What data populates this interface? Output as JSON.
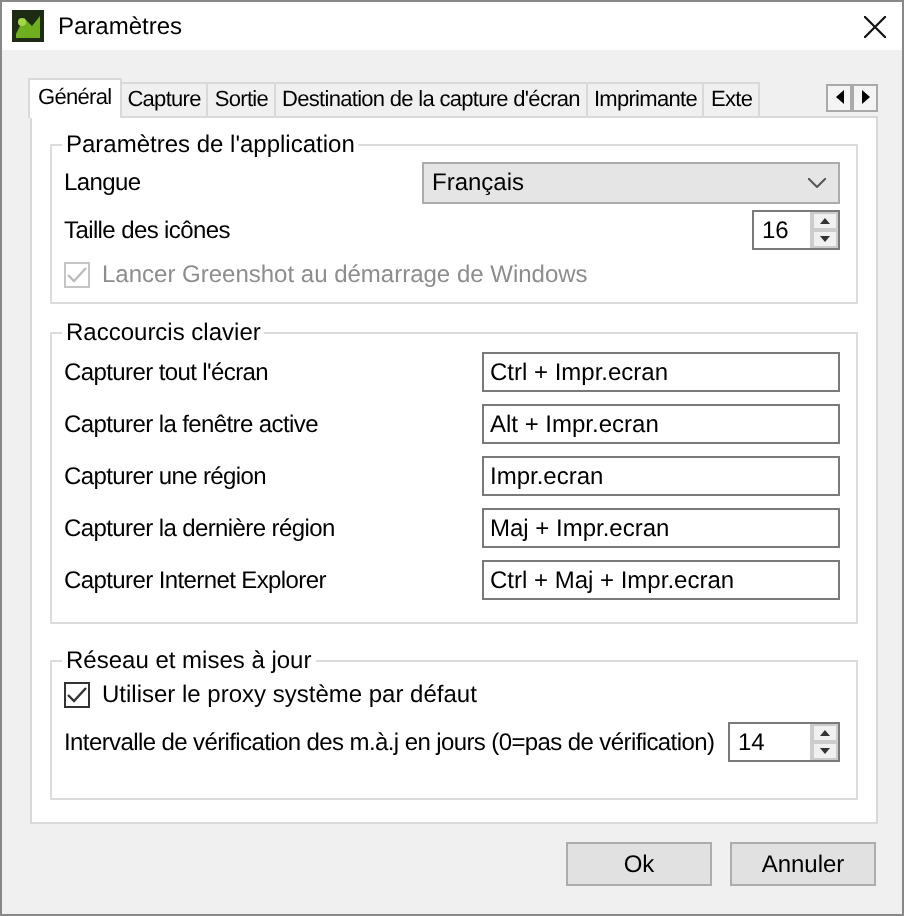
{
  "window": {
    "title": "Paramètres"
  },
  "tabs": [
    {
      "label": "Général",
      "selected": true
    },
    {
      "label": "Capture",
      "selected": false
    },
    {
      "label": "Sortie",
      "selected": false
    },
    {
      "label": "Destination de la capture d'écran",
      "selected": false
    },
    {
      "label": "Imprimante",
      "selected": false
    },
    {
      "label": "Exte",
      "selected": false
    }
  ],
  "application": {
    "legend": "Paramètres de l'application",
    "language": {
      "label": "Langue",
      "value": "Français"
    },
    "icon_size": {
      "label": "Taille des icônes",
      "value": "16"
    },
    "autostart": {
      "label": "Lancer Greenshot au démarrage de Windows",
      "checked": true,
      "disabled": true
    }
  },
  "hotkeys": {
    "legend": "Raccourcis clavier",
    "rows": [
      {
        "label": "Capturer tout l'écran",
        "value": "Ctrl + Impr.ecran"
      },
      {
        "label": "Capturer la fenêtre active",
        "value": "Alt + Impr.ecran"
      },
      {
        "label": "Capturer une région",
        "value": "Impr.ecran"
      },
      {
        "label": "Capturer la dernière région",
        "value": "Maj + Impr.ecran"
      },
      {
        "label": "Capturer Internet Explorer",
        "value": "Ctrl + Maj + Impr.ecran"
      }
    ]
  },
  "network": {
    "legend": "Réseau et mises à jour",
    "proxy": {
      "label": "Utiliser le proxy système par défaut",
      "checked": true,
      "disabled": false
    },
    "interval": {
      "label": "Intervalle de vérification des m.à.j en jours (0=pas de vérification)",
      "value": "14"
    }
  },
  "buttons": [
    "Ok",
    "Annuler"
  ]
}
